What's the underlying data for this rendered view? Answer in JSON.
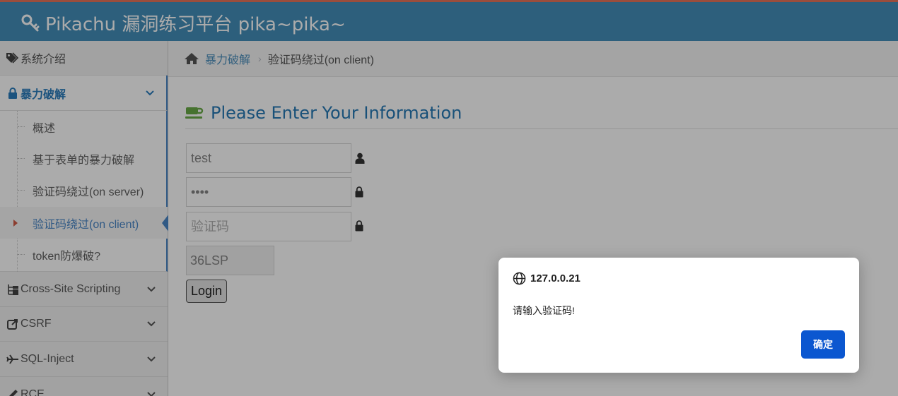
{
  "app": {
    "brand_title": "Pikachu 漏洞练习平台 pika~pika~",
    "accent_color": "#438eb9",
    "header_icon": "key-icon"
  },
  "sidebar": {
    "items": [
      {
        "label": "系统介绍",
        "icon": "tags-icon"
      },
      {
        "label": "暴力破解",
        "icon": "lock-icon",
        "expanded": true
      },
      {
        "label": "Cross-Site Scripting",
        "icon": "sitemap-icon"
      },
      {
        "label": "CSRF",
        "icon": "share-icon"
      },
      {
        "label": "SQL-Inject",
        "icon": "plane-icon"
      },
      {
        "label": "RCE",
        "icon": "pencil-icon"
      }
    ],
    "sub_items": [
      {
        "label": "概述"
      },
      {
        "label": "基于表单的暴力破解"
      },
      {
        "label": "验证码绕过(on server)"
      },
      {
        "label": "验证码绕过(on client)",
        "active": true
      },
      {
        "label": "token防爆破?"
      }
    ]
  },
  "breadcrumb": {
    "parent": "暴力破解",
    "current": "验证码绕过(on client)"
  },
  "form": {
    "heading": "Please Enter Your Information",
    "username_value": "test",
    "password_value": "••••",
    "captcha_placeholder": "验证码",
    "captcha_code": "36LSP",
    "login_label": "Login"
  },
  "dialog": {
    "origin": "127.0.0.21",
    "message": "请输入验证码!",
    "ok_label": "确定",
    "button_color": "#0b57d0"
  }
}
